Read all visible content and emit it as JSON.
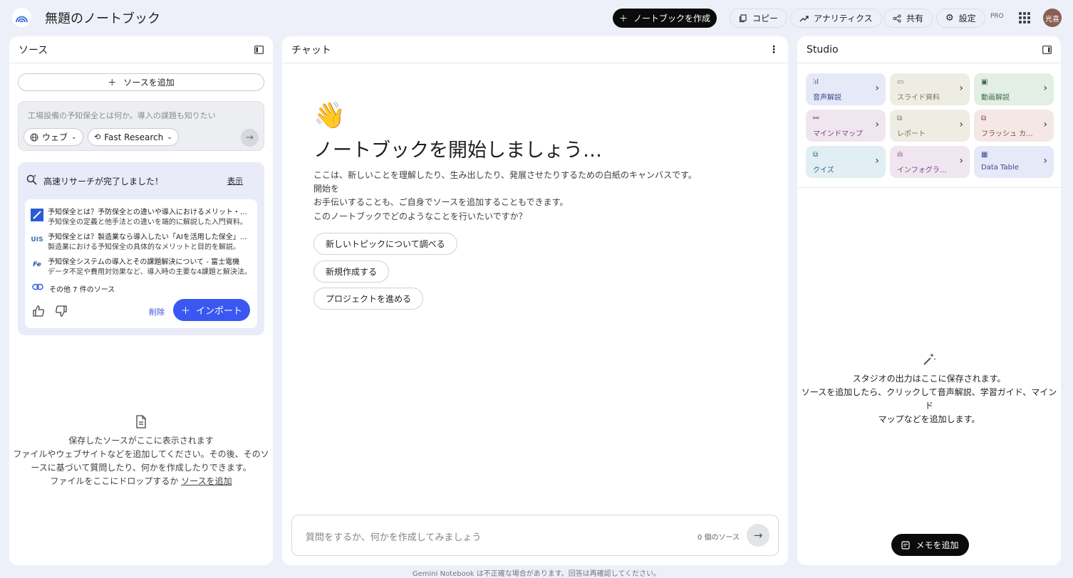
{
  "header": {
    "title": "無題のノートブック",
    "create_label": "ノートブックを作成",
    "copy_label": "コピー",
    "analytics_label": "アナリティクス",
    "share_label": "共有",
    "settings_label": "設定",
    "pro_badge": "PRO",
    "avatar_text": "光喜"
  },
  "sources": {
    "heading": "ソース",
    "add_label": "ソースを追加",
    "search_placeholder": "工場設備の予知保全とは何か。導入の課題も知りたい",
    "web_chip": "ウェブ",
    "research_chip": "Fast Research",
    "research_done": "高速リサーチが完了しました！",
    "show_label": "表示",
    "results": [
      {
        "title": "予知保全とは？予防保全との違いや導入におけるメリット・デ...",
        "desc": "予知保全の定義と他手法との違いを端的に解説した入門資料。"
      },
      {
        "title": "予知保全とは？製造業なら導入したい「AIを活用した保全」を...",
        "desc": "製造業における予知保全の具体的なメリットと目的を解説。"
      },
      {
        "title": "予知保全システムの導入とその課題解決について - 富士電機",
        "desc": "データ不足や費用対効果など、導入時の主要な4課題と解決法。"
      }
    ],
    "more_sources": "その他 7 件のソース",
    "delete_label": "削除",
    "import_label": "インポート",
    "empty_line1": "保存したソースがここに表示されます",
    "empty_line2": "ファイルやウェブサイトなどを追加してください。その後、そのソ",
    "empty_line3": "ースに基づいて質問したり、何かを作成したりできます。",
    "empty_line4": "ファイルをここにドロップするか",
    "empty_link": "ソースを追加"
  },
  "chat": {
    "heading": "チャット",
    "wave": "👋",
    "title": "ノートブックを開始しましょう…",
    "intro_line1": "ここは、新しいことを理解したり、生み出したり、発展させたりするための白紙のキャンバスです。開始を",
    "intro_line2": "お手伝いすることも、ご自身でソースを追加することもできます。",
    "question": "このノートブックでどのようなことを行いたいですか？",
    "suggestions": [
      "新しいトピックについて調べる",
      "新規作成する",
      "プロジェクトを進める"
    ],
    "input_placeholder": "質問をするか、何かを作成してみましょう",
    "source_count": "0 個のソース"
  },
  "studio": {
    "heading": "Studio",
    "tiles": [
      {
        "label": "音声解説",
        "bg": "#e6e9f7",
        "fg": "#3c4a8f"
      },
      {
        "label": "スライド資料",
        "bg": "#eeede4",
        "fg": "#7a7658"
      },
      {
        "label": "動画解説",
        "bg": "#e3efe5",
        "fg": "#3d6b48"
      },
      {
        "label": "マインドマップ",
        "bg": "#efe6f0",
        "fg": "#7d3f83"
      },
      {
        "label": "レポート",
        "bg": "#eeede4",
        "fg": "#7a7658"
      },
      {
        "label": "フラッシュ カ...",
        "bg": "#f4e8e7",
        "fg": "#8d3f3a"
      },
      {
        "label": "クイズ",
        "bg": "#e1eef4",
        "fg": "#2f6a86"
      },
      {
        "label": "インフォグラフ...",
        "bg": "#efe6f0",
        "fg": "#7d3f83"
      },
      {
        "label": "Data Table",
        "bg": "#e6e9f7",
        "fg": "#3c4a8f"
      }
    ],
    "empty_line1": "スタジオの出力はここに保存されます。",
    "empty_line2": "ソースを追加したら、クリックして音声解説、学習ガイド、マインド",
    "empty_line3": "マップなどを追加します。",
    "memo_label": "メモを追加"
  },
  "footer": "Gemini Notebook は不正確な場合があります。回答は再確認してください。"
}
